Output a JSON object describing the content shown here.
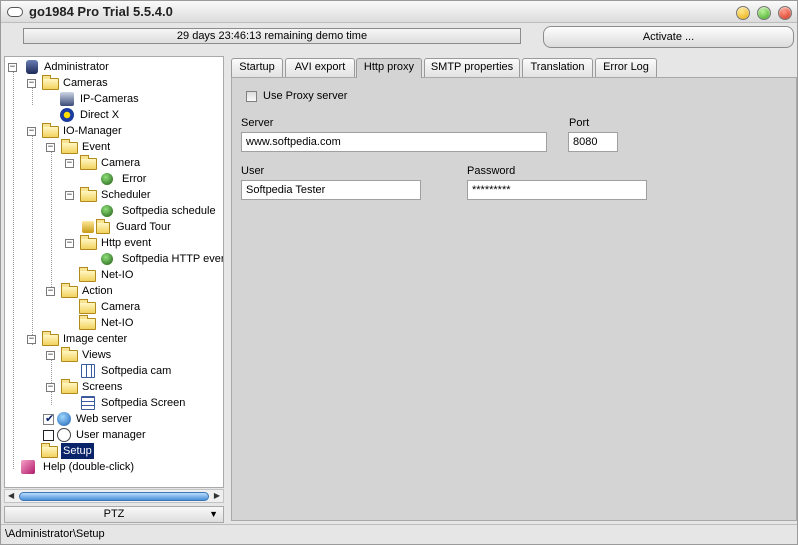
{
  "window": {
    "title": "go1984 Pro Trial 5.5.4.0"
  },
  "demo": {
    "remaining": "29 days 23:46:13 remaining demo time",
    "activate_label": "Activate ..."
  },
  "tree": {
    "administrator": "Administrator",
    "cameras": "Cameras",
    "ip_cameras": "IP-Cameras",
    "direct_x": "Direct X",
    "io_manager": "IO-Manager",
    "event": "Event",
    "camera": "Camera",
    "error": "Error",
    "scheduler": "Scheduler",
    "softpedia_schedule": "Softpedia schedule",
    "guard_tour": "Guard Tour",
    "http_event": "Http event",
    "softpedia_http_event": "Softpedia HTTP event",
    "net_io": "Net-IO",
    "action": "Action",
    "action_camera": "Camera",
    "action_net_io": "Net-IO",
    "image_center": "Image center",
    "views": "Views",
    "softpedia_cam": "Softpedia cam",
    "screens": "Screens",
    "softpedia_screen": "Softpedia Screen",
    "web_server": "Web server",
    "user_manager": "User manager",
    "setup": "Setup",
    "help": "Help (double-click)"
  },
  "ptz": {
    "label": "PTZ"
  },
  "status": {
    "path": "\\Administrator\\Setup"
  },
  "tabs": [
    {
      "label": "Startup"
    },
    {
      "label": "AVI export"
    },
    {
      "label": "Http proxy"
    },
    {
      "label": "SMTP properties"
    },
    {
      "label": "Translation"
    },
    {
      "label": "Error Log"
    }
  ],
  "proxy": {
    "use_proxy_label": "Use Proxy server",
    "server_label": "Server",
    "server_value": "www.softpedia.com",
    "port_label": "Port",
    "port_value": "8080",
    "user_label": "User",
    "user_value": "Softpedia Tester",
    "password_label": "Password",
    "password_value": "*********"
  }
}
